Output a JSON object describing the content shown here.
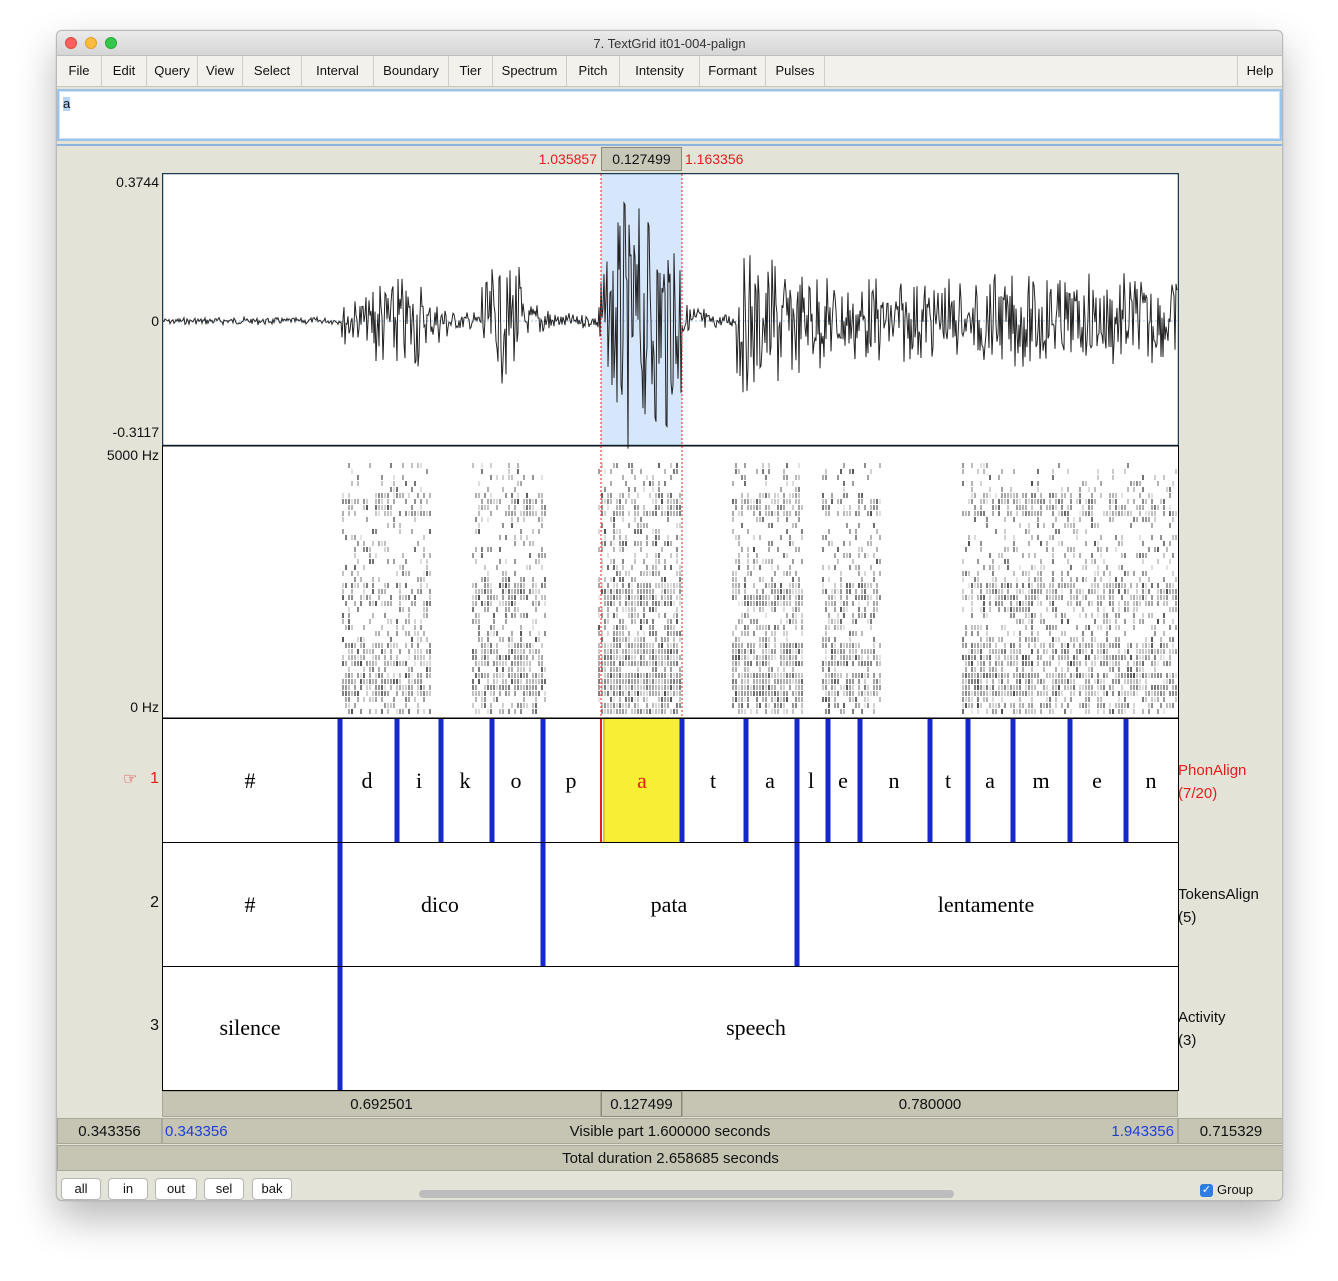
{
  "window": {
    "title": "7. TextGrid it01-004-palign"
  },
  "menu": {
    "items": [
      "File",
      "Edit",
      "Query",
      "View",
      "Select",
      "Interval",
      "Boundary",
      "Tier",
      "Spectrum",
      "Pitch",
      "Intensity",
      "Formant",
      "Pulses"
    ],
    "help": "Help"
  },
  "textfield": {
    "value": "a"
  },
  "selection": {
    "start": "1.035857",
    "duration": "0.127499",
    "end": "1.163356"
  },
  "waveform": {
    "max": "0.3744",
    "zero": "0",
    "min": "-0.3117"
  },
  "spectrogram": {
    "max": "5000 Hz",
    "min": "0 Hz"
  },
  "tiers": [
    {
      "number": "1",
      "name": "PhonAlign",
      "count": "(7/20)",
      "pointer": "☞",
      "labels": [
        "#",
        "d",
        "i",
        "k",
        "o",
        "p",
        "a",
        "t",
        "a",
        "l",
        "e",
        "n",
        "t",
        "a",
        "m",
        "e",
        "n"
      ]
    },
    {
      "number": "2",
      "name": "TokensAlign",
      "count": "(5)",
      "labels": [
        "#",
        "dico",
        "pata",
        "lentamente"
      ]
    },
    {
      "number": "3",
      "name": "Activity",
      "count": "(3)",
      "labels": [
        "silence",
        "speech"
      ]
    }
  ],
  "durations": {
    "before": "0.692501",
    "selected": "0.127499",
    "after": "0.780000"
  },
  "visible": {
    "left_total": "0.343356",
    "start": "0.343356",
    "text": "Visible part 1.600000 seconds",
    "end": "1.943356",
    "right_total": "0.715329"
  },
  "total": {
    "text": "Total duration 2.658685 seconds"
  },
  "buttons": [
    "all",
    "in",
    "out",
    "sel",
    "bak"
  ],
  "group": {
    "label": "Group",
    "checked": true
  },
  "colors": {
    "boundary": "#1528c9",
    "selection_fill": "#d6e6fb",
    "selected_interval": "#f8ef34",
    "selected_text": "#e31d1d"
  }
}
